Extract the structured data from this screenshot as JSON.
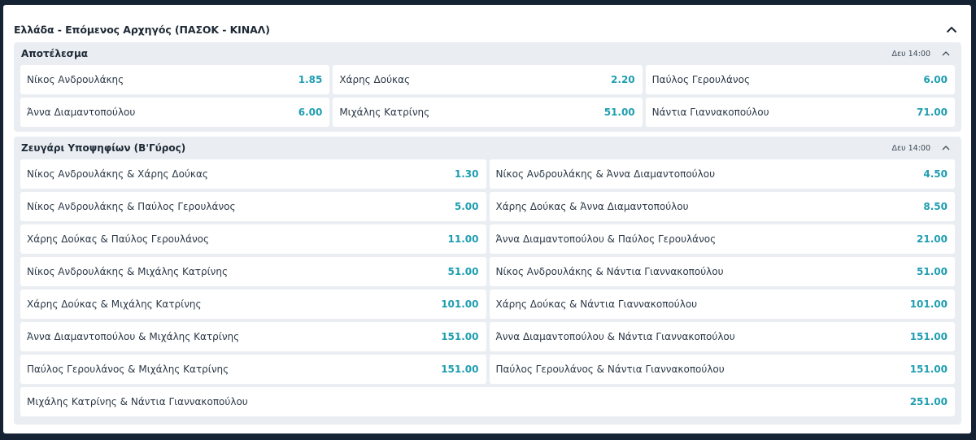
{
  "event": {
    "title": "Ελλάδα - Επόμενος Αρχηγός (ΠΑΣΟΚ - ΚΙΝΑΛ)"
  },
  "markets": [
    {
      "name": "Αποτέλεσμα",
      "time": "Δευ 14:00",
      "selections": [
        {
          "name": "Νίκος Ανδρουλάκης",
          "odd": "1.85"
        },
        {
          "name": "Χάρης Δούκας",
          "odd": "2.20"
        },
        {
          "name": "Παύλος Γερουλάνος",
          "odd": "6.00"
        },
        {
          "name": "Άννα Διαμαντοπούλου",
          "odd": "6.00"
        },
        {
          "name": "Μιχάλης Κατρίνης",
          "odd": "51.00"
        },
        {
          "name": "Νάντια Γιαννακοπούλου",
          "odd": "71.00"
        }
      ]
    },
    {
      "name": "Ζευγάρι Υποψηφίων (Β'Γύρος)",
      "time": "Δευ 14:00",
      "selections": [
        {
          "name": "Νίκος Ανδρουλάκης & Χάρης Δούκας",
          "odd": "1.30"
        },
        {
          "name": "Νίκος Ανδρουλάκης & Άννα Διαμαντοπούλου",
          "odd": "4.50"
        },
        {
          "name": "Νίκος Ανδρουλάκης & Παύλος Γερουλάνος",
          "odd": "5.00"
        },
        {
          "name": "Χάρης Δούκας & Άννα Διαμαντοπούλου",
          "odd": "8.50"
        },
        {
          "name": "Χάρης Δούκας & Παύλος Γερουλάνος",
          "odd": "11.00"
        },
        {
          "name": "Άννα Διαμαντοπούλου & Παύλος Γερουλάνος",
          "odd": "21.00"
        },
        {
          "name": "Νίκος Ανδρουλάκης & Μιχάλης Κατρίνης",
          "odd": "51.00"
        },
        {
          "name": "Νίκος Ανδρουλάκης & Νάντια Γιαννακοπούλου",
          "odd": "51.00"
        },
        {
          "name": "Χάρης Δούκας & Μιχάλης Κατρίνης",
          "odd": "101.00"
        },
        {
          "name": "Χάρης Δούκας & Νάντια Γιαννακοπούλου",
          "odd": "101.00"
        },
        {
          "name": "Άννα Διαμαντοπούλου & Μιχάλης Κατρίνης",
          "odd": "151.00"
        },
        {
          "name": "Άννα Διαμαντοπούλου & Νάντια Γιαννακοπούλου",
          "odd": "151.00"
        },
        {
          "name": "Παύλος Γερουλάνος & Μιχάλης Κατρίνης",
          "odd": "151.00"
        },
        {
          "name": "Παύλος Γερουλάνος & Νάντια Γιαννακοπούλου",
          "odd": "151.00"
        },
        {
          "name": "Μιχάλης Κατρίνης & Νάντια Γιαννακοπούλου",
          "odd": "251.00"
        }
      ]
    }
  ],
  "icons": {
    "collapse_event": "chevron-up-icon",
    "collapse_market": "chevron-up-icon"
  },
  "colors": {
    "odds": "#1e9eb0",
    "market_bg": "#eaeef2",
    "page_bg": "#152233"
  }
}
